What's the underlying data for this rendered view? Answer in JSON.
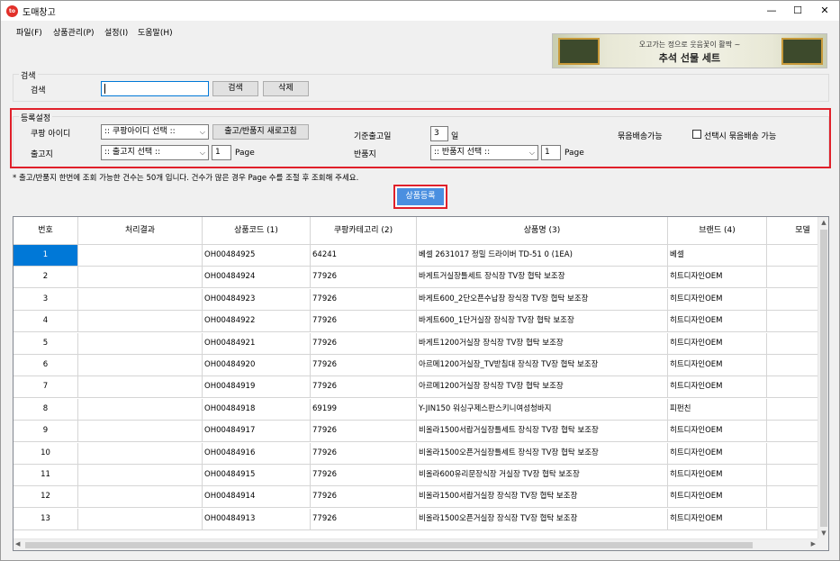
{
  "window": {
    "title": "도매창고",
    "app_icon_text": "to"
  },
  "controls": {
    "minimize": "—",
    "maximize": "☐",
    "close": "✕"
  },
  "menu": [
    {
      "label": "파일(F)"
    },
    {
      "label": "상품관리(P)"
    },
    {
      "label": "설정(I)"
    },
    {
      "label": "도움말(H)"
    }
  ],
  "banner": {
    "subtitle": "오고가는 정으로 웃음꽃이 활짝 ~",
    "title": "추석 선물 세트"
  },
  "search": {
    "group_title": "검색",
    "label": "검색",
    "value": "",
    "search_button": "검색",
    "delete_button": "삭제"
  },
  "register": {
    "group_title": "등록설정",
    "coupang_id_label": "쿠팡 아이디",
    "coupang_id_selected": ":: 쿠팡아이디 선택 ::",
    "refresh_button": "출고/반품지 새로고침",
    "base_ship_label": "기준출고일",
    "base_ship_value": "3",
    "base_ship_unit": "일",
    "bundle_label": "묶음배송가능",
    "bundle_checkbox_label": "선택시 묶음배송 가능",
    "bundle_checked": false,
    "ship_from_label": "출고지",
    "ship_from_selected": ":: 출고지 선택 ::",
    "ship_from_page": "1",
    "page_label": "Page",
    "return_label": "반품지",
    "return_selected": ":: 반품지 선택 ::",
    "return_page": "1"
  },
  "notice": "* 출고/반품지 한번에 조회 가능한 건수는 50개 입니다. 건수가 많은 경우 Page 수를 조절 후 조회해 주세요.",
  "register_button": "상품등록",
  "table": {
    "columns": [
      "번호",
      "처리결과",
      "상품코드 (1)",
      "쿠팡카테고리 (2)",
      "상품명 (3)",
      "브랜드 (4)",
      "모델"
    ],
    "rows": [
      {
        "no": "1",
        "result": "",
        "code": "OH00484925",
        "category": "64241",
        "name": "베셀 2631017 정밀 드라이버 TD-51 0 (1EA)",
        "brand": "베셀"
      },
      {
        "no": "2",
        "result": "",
        "code": "OH00484924",
        "category": "77926",
        "name": "바게트거실장틀세트 장식장 TV장 협탁 보조장",
        "brand": "히트디자인OEM"
      },
      {
        "no": "3",
        "result": "",
        "code": "OH00484923",
        "category": "77926",
        "name": "바게트600_2단오픈수납장 장식장 TV장 협탁 보조장",
        "brand": "히트디자인OEM"
      },
      {
        "no": "4",
        "result": "",
        "code": "OH00484922",
        "category": "77926",
        "name": "바게트600_1단거실장 장식장 TV장 협탁 보조장",
        "brand": "히트디자인OEM"
      },
      {
        "no": "5",
        "result": "",
        "code": "OH00484921",
        "category": "77926",
        "name": "바게트1200거실장 장식장 TV장 협탁 보조장",
        "brand": "히트디자인OEM"
      },
      {
        "no": "6",
        "result": "",
        "code": "OH00484920",
        "category": "77926",
        "name": "아르메1200거실장_TV받침대 장식장 TV장 협탁 보조장",
        "brand": "히트디자인OEM"
      },
      {
        "no": "7",
        "result": "",
        "code": "OH00484919",
        "category": "77926",
        "name": "아르메1200거실장 장식장 TV장 협탁 보조장",
        "brand": "히트디자인OEM"
      },
      {
        "no": "8",
        "result": "",
        "code": "OH00484918",
        "category": "69199",
        "name": "Y-JIN150 워싱구제스판스키니여성청바지",
        "brand": "피펀친"
      },
      {
        "no": "9",
        "result": "",
        "code": "OH00484917",
        "category": "77926",
        "name": "비올라1500서랍거실장틀세트 장식장 TV장 협탁 보조장",
        "brand": "히트디자인OEM"
      },
      {
        "no": "10",
        "result": "",
        "code": "OH00484916",
        "category": "77926",
        "name": "비올라1500오픈거실장틀세트 장식장 TV장 협탁 보조장",
        "brand": "히트디자인OEM"
      },
      {
        "no": "11",
        "result": "",
        "code": "OH00484915",
        "category": "77926",
        "name": "비올라600유리문장식장 거실장 TV장 협탁 보조장",
        "brand": "히트디자인OEM"
      },
      {
        "no": "12",
        "result": "",
        "code": "OH00484914",
        "category": "77926",
        "name": "비올라1500서랍거실장 장식장 TV장 협탁 보조장",
        "brand": "히트디자인OEM"
      },
      {
        "no": "13",
        "result": "",
        "code": "OH00484913",
        "category": "77926",
        "name": "비올라1500오픈거실장 장식장 TV장 협탁 보조장",
        "brand": "히트디자인OEM"
      }
    ]
  },
  "colors": {
    "accent": "#0078d7",
    "highlight": "#e0202a",
    "button_blue": "#4a8fe0"
  }
}
